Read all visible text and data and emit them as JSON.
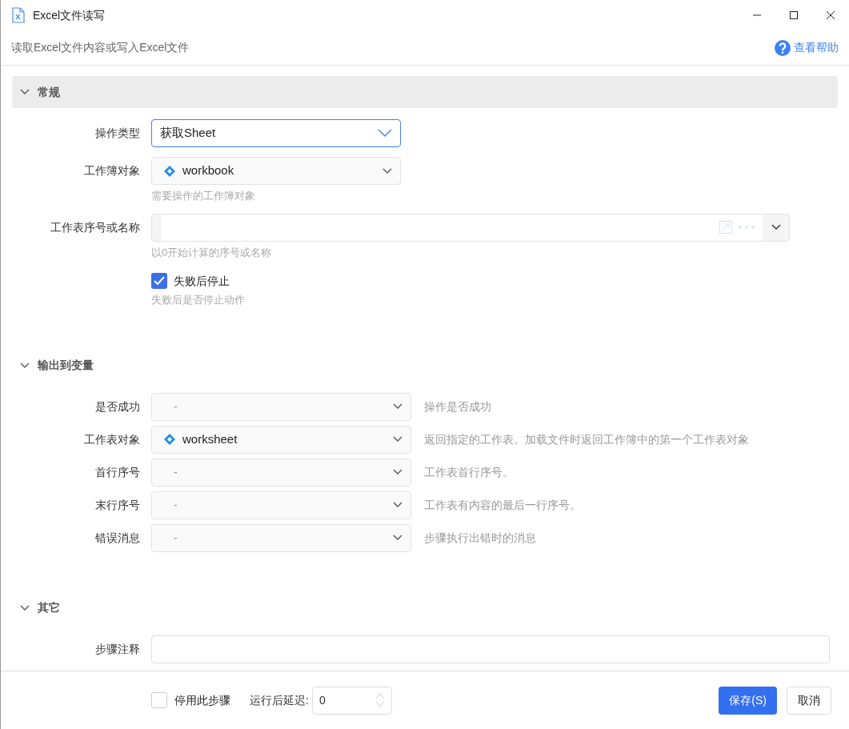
{
  "window": {
    "title": "Excel文件读写"
  },
  "header": {
    "description": "读取Excel文件内容或写入Excel文件",
    "help_link": "查看帮助"
  },
  "sections": [
    {
      "title": "常规",
      "expanded": true,
      "highlighted": true,
      "fields": [
        {
          "kind": "select",
          "label": "操作类型",
          "value": "获取Sheet",
          "focused": true
        },
        {
          "kind": "variable",
          "label": "工作簿对象",
          "value": "workbook",
          "hint": "需要操作的工作簿对象"
        },
        {
          "kind": "expression",
          "label": "工作表序号或名称",
          "hint": "以0开始计算的序号或名称"
        },
        {
          "kind": "checkbox",
          "label": "失败后停止",
          "checked": true,
          "hint": "失败后是否停止动作"
        }
      ]
    },
    {
      "title": "输出到变量",
      "expanded": true,
      "highlighted": false,
      "fields": [
        {
          "kind": "empty",
          "label": "是否成功",
          "value": "-",
          "description": "操作是否成功"
        },
        {
          "kind": "variable",
          "label": "工作表对象",
          "value": "worksheet",
          "description": "返回指定的工作表。加载文件时返回工作簿中的第一个工作表对象"
        },
        {
          "kind": "empty",
          "label": "首行序号",
          "value": "-",
          "description": "工作表首行序号。"
        },
        {
          "kind": "empty",
          "label": "末行序号",
          "value": "-",
          "description": "工作表有内容的最后一行序号。"
        },
        {
          "kind": "empty",
          "label": "错误消息",
          "value": "-",
          "description": "步骤执行出错时的消息"
        }
      ]
    },
    {
      "title": "其它",
      "expanded": true,
      "highlighted": false,
      "fields": [
        {
          "kind": "text",
          "label": "步骤注释"
        }
      ]
    }
  ],
  "footer": {
    "disable_step": {
      "label": "停用此步骤",
      "checked": false
    },
    "delay": {
      "label": "运行后延迟:",
      "value": "0"
    },
    "buttons": [
      {
        "label": "保存(S)",
        "primary": true
      },
      {
        "label": "取消",
        "primary": false
      }
    ]
  }
}
